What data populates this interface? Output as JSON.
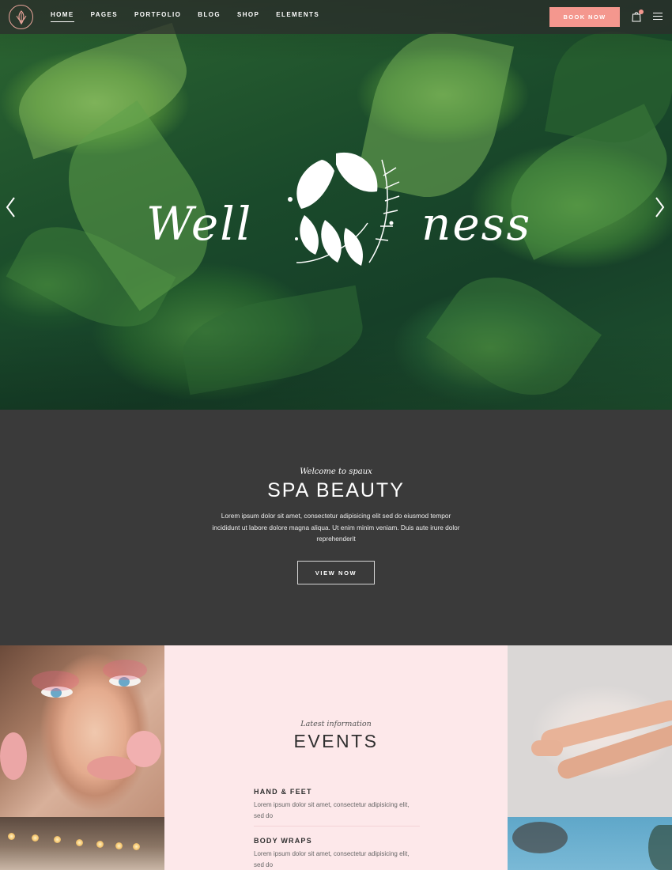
{
  "nav": {
    "items": [
      {
        "label": "HOME",
        "active": true
      },
      {
        "label": "PAGES",
        "active": false
      },
      {
        "label": "PORTFOLIO",
        "active": false
      },
      {
        "label": "BLOG",
        "active": false
      },
      {
        "label": "SHOP",
        "active": false
      },
      {
        "label": "ELEMENTS",
        "active": false
      }
    ],
    "book_label": "BOOK NOW",
    "cart_icon": "shopping-bag-icon",
    "menu_icon": "hamburger-icon",
    "logo_icon": "leaf-logo-icon"
  },
  "hero": {
    "word_left": "Well",
    "word_right": "ness",
    "emblem_icon": "tropical-leaves-emblem",
    "prev_icon": "chevron-left-icon",
    "next_icon": "chevron-right-icon"
  },
  "intro": {
    "kicker": "Welcome to spaux",
    "title": "SPA BEAUTY",
    "text": "Lorem ipsum dolor sit amet, consectetur adipisicing elit sed do eiusmod tempor incididunt ut labore dolore magna aliqua. Ut enim minim veniam. Duis aute irure dolor reprehenderit",
    "button_label": "VIEW NOW"
  },
  "events": {
    "kicker": "Latest information",
    "title": "EVENTS",
    "items": [
      {
        "name": "HAND & FEET",
        "desc": "Lorem ipsum dolor sit amet, consectetur adipisicing elit, sed do"
      },
      {
        "name": "BODY WRAPS",
        "desc": "Lorem ipsum dolor sit amet, consectetur adipisicing elit, sed do"
      }
    ]
  },
  "colors": {
    "accent": "#f4978e",
    "dark_section": "#3a3a3a",
    "events_bg": "#fde8ea"
  }
}
